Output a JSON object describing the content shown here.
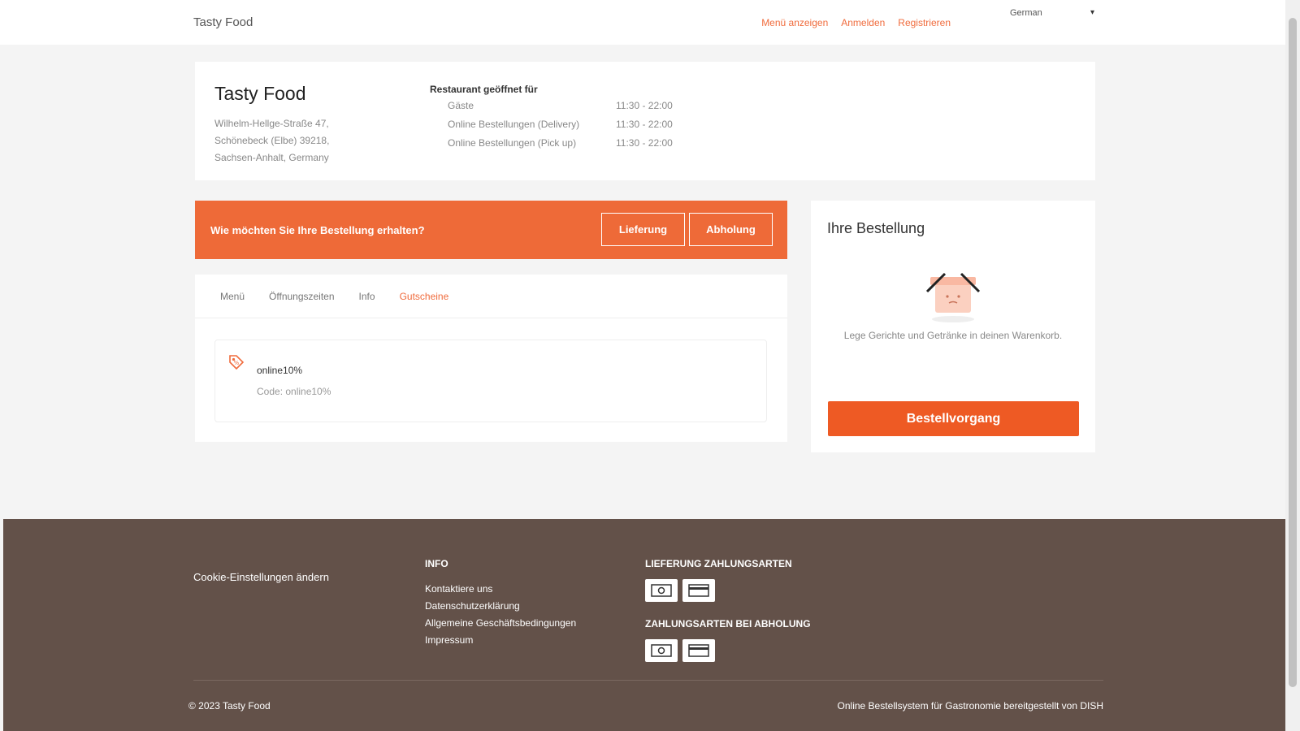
{
  "header": {
    "brand": "Tasty Food",
    "nav": [
      "Menü anzeigen",
      "Anmelden",
      "Registrieren"
    ],
    "language": "German",
    "accent_color": "#f06b3c"
  },
  "restaurant": {
    "name": "Tasty Food",
    "address": [
      "Wilhelm-Hellge-Straße 47,",
      "Schönebeck (Elbe) 39218,",
      "Sachsen-Anhalt, Germany"
    ],
    "hours_title": "Restaurant geöffnet für",
    "hours": [
      {
        "label": "Gäste",
        "time": "11:30 - 22:00"
      },
      {
        "label": "Online Bestellungen (Delivery)",
        "time": "11:30 - 22:00"
      },
      {
        "label": "Online Bestellungen (Pick up)",
        "time": "11:30 - 22:00"
      }
    ]
  },
  "order_type": {
    "question": "Wie möchten Sie Ihre Bestellung erhalten?",
    "delivery": "Lieferung",
    "pickup": "Abholung",
    "bar_color": "#ee6a38"
  },
  "tabs": {
    "items": [
      "Menü",
      "Öffnungszeiten",
      "Info",
      "Gutscheine"
    ],
    "active": "Gutscheine"
  },
  "coupon": {
    "name": "online10%",
    "code": "Code: online10%"
  },
  "cart": {
    "title": "Ihre Bestellung",
    "empty_text": "Lege Gerichte und Getränke in deinen Warenkorb.",
    "checkout": "Bestellvorgang",
    "button_color": "#ee5a24"
  },
  "footer": {
    "cookie": "Cookie-Einstellungen ändern",
    "info_heading": "INFO",
    "info_links": [
      "Kontaktiere uns",
      "Datenschutzerklärung",
      "Allgemeine Geschäftsbedingungen",
      "Impressum"
    ],
    "delivery_pay_heading": "LIEFERUNG ZAHLUNGSARTEN",
    "pickup_pay_heading": "ZAHLUNGSARTEN BEI ABHOLUNG",
    "pay_icons": [
      "cash-icon",
      "card-icon"
    ],
    "copyright": "© 2023 Tasty Food",
    "powered": "Online Bestellsystem für Gastronomie bereitgestellt von DISH",
    "bg_color": "#635149"
  }
}
